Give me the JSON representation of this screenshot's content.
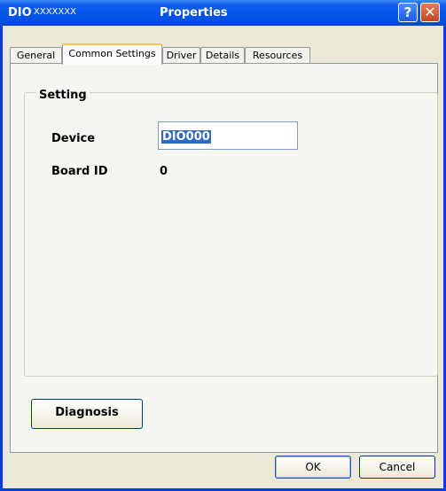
{
  "titlebar": {
    "prefix": "DIO",
    "obscured": "XXXXXXX",
    "title": "Properties",
    "help_label": "?",
    "close_label": "✕"
  },
  "tabs": [
    {
      "label": "General",
      "active": false
    },
    {
      "label": "Common Settings",
      "active": true
    },
    {
      "label": "Driver",
      "active": false
    },
    {
      "label": "Details",
      "active": false
    },
    {
      "label": "Resources",
      "active": false
    }
  ],
  "setting": {
    "group_label": "Setting",
    "device_label": "Device",
    "device_value": "DIO000",
    "board_id_label": "Board ID",
    "board_id_value": "0"
  },
  "buttons": {
    "diagnosis": "Diagnosis",
    "ok": "OK",
    "cancel": "Cancel"
  }
}
